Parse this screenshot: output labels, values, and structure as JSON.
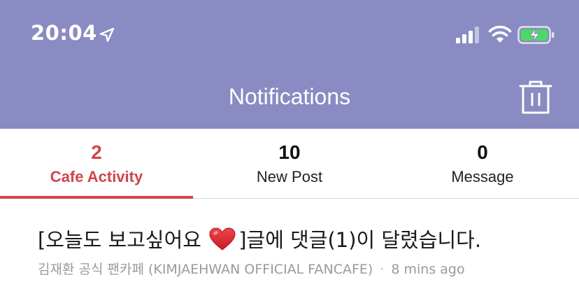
{
  "status_bar": {
    "time": "20:04"
  },
  "header": {
    "title": "Notifications"
  },
  "tabs": [
    {
      "count": "2",
      "label": "Cafe Activity",
      "active": true
    },
    {
      "count": "10",
      "label": "New Post",
      "active": false
    },
    {
      "count": "0",
      "label": "Message",
      "active": false
    }
  ],
  "notifications": [
    {
      "text_before_icon": "[오늘도 보고싶어요",
      "icon": "heart-icon",
      "text_after_icon": "]글에 댓글(1)이 달렸습니다.",
      "source": "김재환 공식 팬카페 (KIMJAEHWAN OFFICIAL FANCAFE)",
      "separator": "·",
      "time_ago": "8 mins ago"
    }
  ],
  "colors": {
    "header_bg": "#8a8bc2",
    "active_tab": "#d0454b",
    "battery_charge": "#4cd964"
  }
}
